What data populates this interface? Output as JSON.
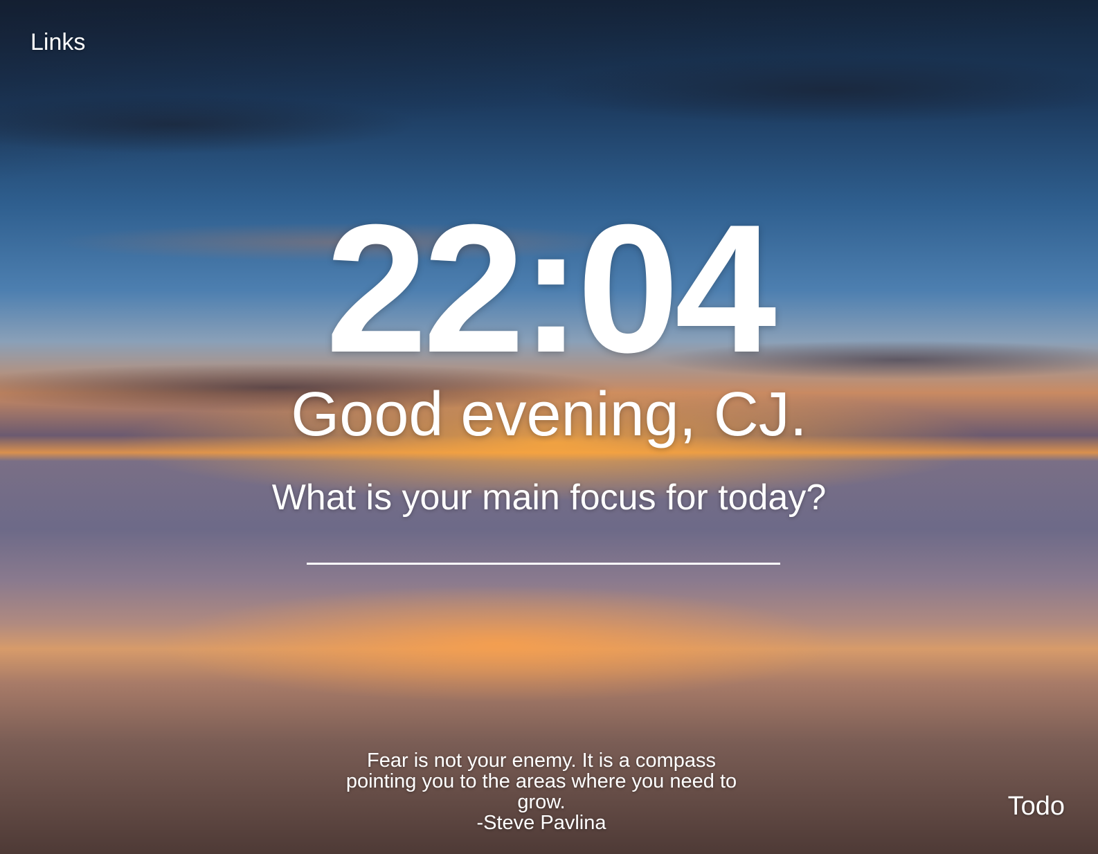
{
  "links": {
    "label": "Links"
  },
  "clock": {
    "time": "22:04"
  },
  "greeting": {
    "text": "Good evening, CJ."
  },
  "focus": {
    "question": "What is your main focus for today?",
    "value": ""
  },
  "quote": {
    "text": "Fear is not your enemy.  It is a compass pointing you to the areas where you need to grow.",
    "author": "-Steve Pavlina"
  },
  "todo": {
    "label": "Todo"
  },
  "colors": {
    "text": "#ffffff",
    "sky_top": "#14263d",
    "sunset": "#d9904e"
  }
}
